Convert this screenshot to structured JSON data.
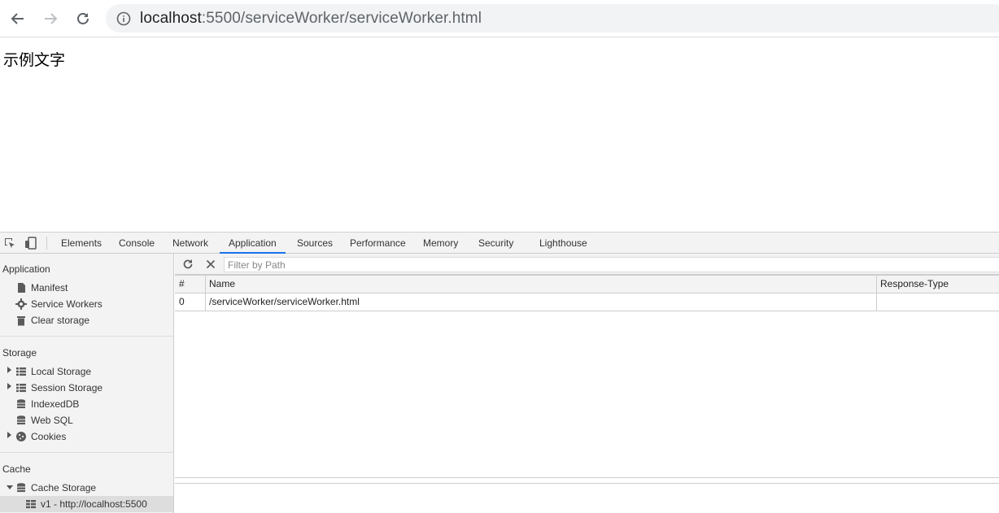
{
  "browser": {
    "url_host": "localhost",
    "url_rest": ":5500/serviceWorker/serviceWorker.html"
  },
  "page": {
    "text": "示例文字"
  },
  "devtools": {
    "tabs": [
      "Elements",
      "Console",
      "Network",
      "Application",
      "Sources",
      "Performance",
      "Memory",
      "Security",
      "Lighthouse"
    ],
    "active_tab": "Application",
    "sidebar": {
      "application_header": "Application",
      "application_items": [
        "Manifest",
        "Service Workers",
        "Clear storage"
      ],
      "storage_header": "Storage",
      "storage_items": [
        "Local Storage",
        "Session Storage",
        "IndexedDB",
        "Web SQL",
        "Cookies"
      ],
      "cache_header": "Cache",
      "cache_items": [
        "Cache Storage",
        "v1 - http://localhost:5500"
      ]
    },
    "filter_placeholder": "Filter by Path",
    "table": {
      "columns": [
        "#",
        "Name",
        "Response-Type"
      ],
      "rows": [
        {
          "index": "0",
          "name": "/serviceWorker/serviceWorker.html",
          "response_type": ""
        }
      ]
    }
  }
}
